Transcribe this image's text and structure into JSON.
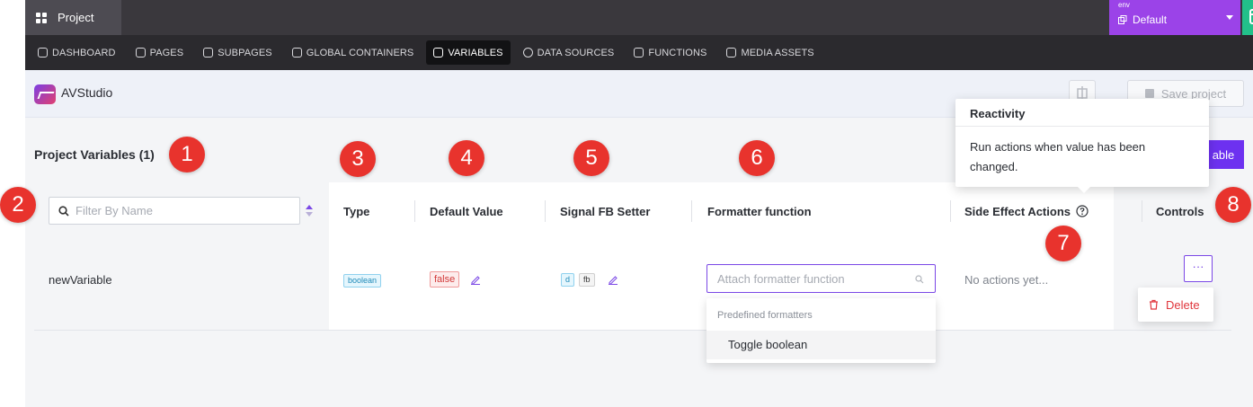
{
  "topbar": {
    "project_tab": "Project",
    "env_label": "env",
    "env_value": "Default"
  },
  "nav": [
    {
      "label": "DASHBOARD",
      "icon": "home-icon"
    },
    {
      "label": "PAGES",
      "icon": "page-icon"
    },
    {
      "label": "SUBPAGES",
      "icon": "subpage-icon"
    },
    {
      "label": "GLOBAL CONTAINERS",
      "icon": "container-icon"
    },
    {
      "label": "VARIABLES",
      "icon": "variable-icon",
      "active": true
    },
    {
      "label": "DATA SOURCES",
      "icon": "database-icon"
    },
    {
      "label": "FUNCTIONS",
      "icon": "function-icon"
    },
    {
      "label": "MEDIA ASSETS",
      "icon": "image-icon"
    }
  ],
  "header": {
    "app_name": "AVStudio",
    "save_label": "Save project"
  },
  "main": {
    "title": "Project Variables (1)",
    "add_button_label": "able",
    "filter_placeholder": "Filter By Name",
    "columns": {
      "type": "Type",
      "default_value": "Default Value",
      "signal_fb_setter": "Signal FB Setter",
      "formatter": "Formatter function",
      "side_effects": "Side Effect Actions",
      "controls": "Controls"
    },
    "row": {
      "name": "newVariable",
      "type": "boolean",
      "default_value": "false",
      "setter_tags": [
        "d",
        "fb"
      ],
      "formatter_placeholder": "Attach formatter function",
      "side_effects": "No actions yet...",
      "controls_label": "···"
    },
    "formatter_dropdown": {
      "group": "Predefined formatters",
      "items": [
        "Toggle boolean"
      ]
    },
    "controls_menu": {
      "delete_label": "Delete"
    }
  },
  "tooltip": {
    "title": "Reactivity",
    "body": "Run actions when value has been changed."
  },
  "markers": [
    "1",
    "2",
    "3",
    "4",
    "5",
    "6",
    "7",
    "8"
  ],
  "colors": {
    "accent": "#6d31f0",
    "env": "#9b43e8",
    "preview": "#22c08a",
    "marker": "#e8332d",
    "danger": "#e0363c"
  }
}
